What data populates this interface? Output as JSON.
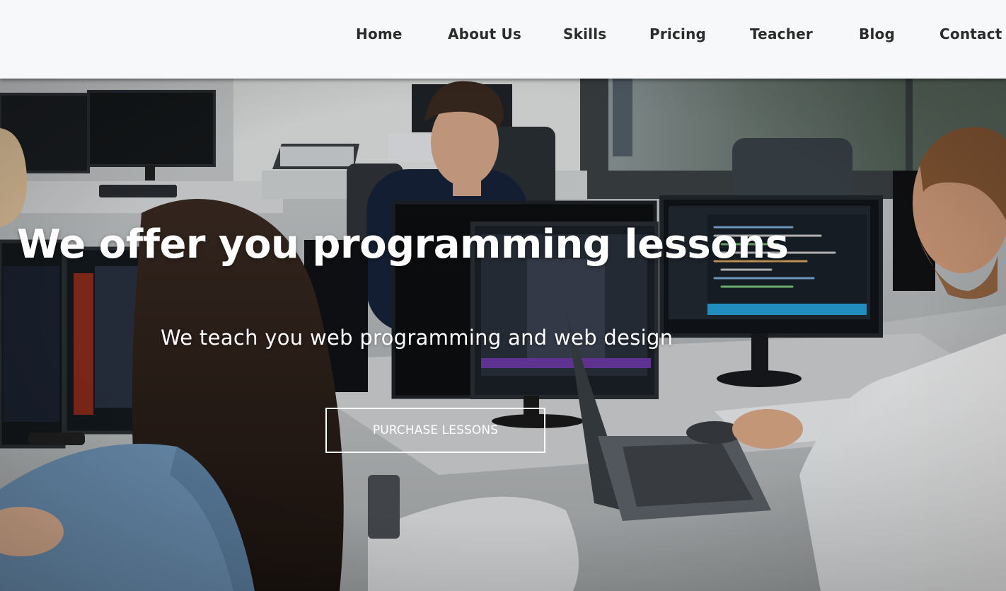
{
  "nav": {
    "items": [
      {
        "label": "Home"
      },
      {
        "label": "About Us"
      },
      {
        "label": "Skills"
      },
      {
        "label": "Pricing"
      },
      {
        "label": "Teacher"
      },
      {
        "label": "Blog"
      },
      {
        "label": "Contact"
      }
    ]
  },
  "hero": {
    "title": "We offer you programming lessons",
    "subtitle": "We teach you web programming and web design",
    "cta_label": "PURCHASE LESSONS"
  }
}
